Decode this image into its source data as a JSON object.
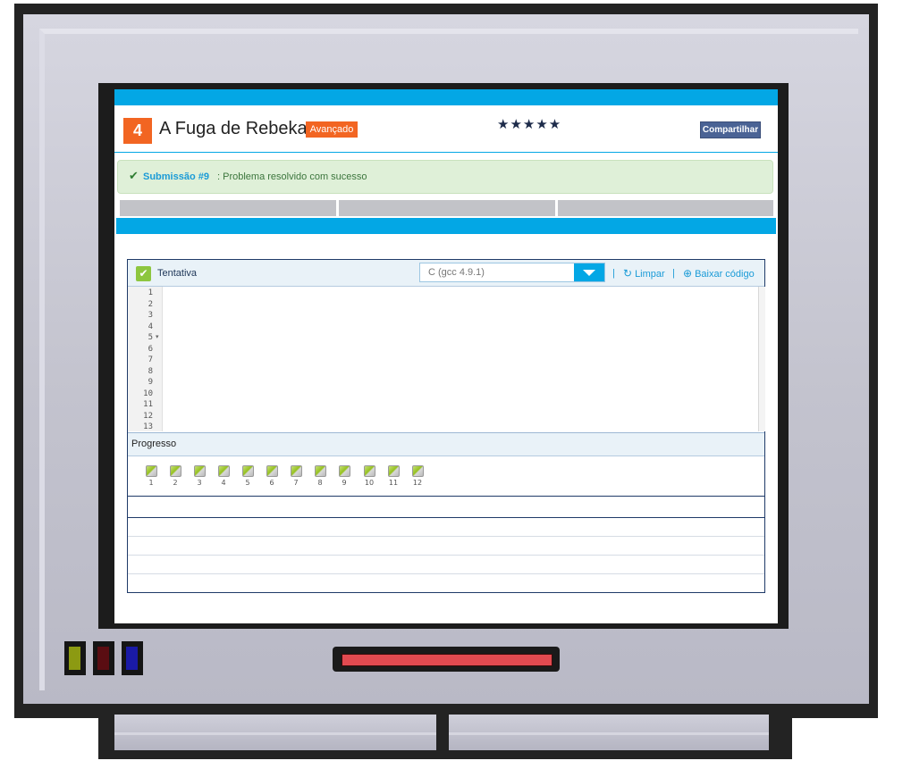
{
  "problem": {
    "number": "4",
    "title": "A Fuga de Rebeka",
    "level": "Avançado",
    "rating_stars": "★★★★★",
    "share_label": "Compartilhar"
  },
  "alert": {
    "submission_label": "Submissão #9",
    "message": ": Problema resolvido com sucesso"
  },
  "tabs": [
    "",
    "",
    ""
  ],
  "editor": {
    "attempt_label": "Tentativa",
    "language": "C (gcc 4.9.1)",
    "separator": "|",
    "clear_label": "Limpar",
    "download_label": "Baixar código",
    "line_numbers": [
      "1",
      "2",
      "3",
      "4",
      "5",
      "6",
      "7",
      "8",
      "9",
      "10",
      "11",
      "12",
      "13"
    ]
  },
  "progress": {
    "label": "Progresso",
    "tests": [
      "1",
      "2",
      "3",
      "4",
      "5",
      "6",
      "7",
      "8",
      "9",
      "10",
      "11",
      "12"
    ]
  },
  "colors": {
    "accent_blue": "#03a7e5",
    "badge_orange": "#f26522",
    "success_green": "#8dc63f",
    "share_blue": "#4a6395"
  },
  "icons": {
    "check": "check-icon",
    "refresh": "refresh-icon",
    "download": "download-icon",
    "dropdown": "chevron-down-icon"
  }
}
